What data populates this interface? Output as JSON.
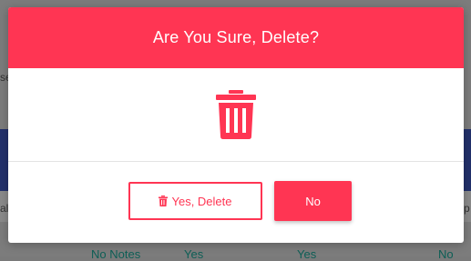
{
  "modal": {
    "title": "Are You Sure, Delete?",
    "yes_label": "Yes, Delete",
    "no_label": "No",
    "accent_color": "#ff3553",
    "icon": "trash-icon"
  },
  "background": {
    "left_fragment": "se",
    "row_left_fragment": "al",
    "row_right_fragment": "p",
    "table_cells": [
      "No Notes",
      "Yes",
      "Yes",
      "No"
    ]
  }
}
